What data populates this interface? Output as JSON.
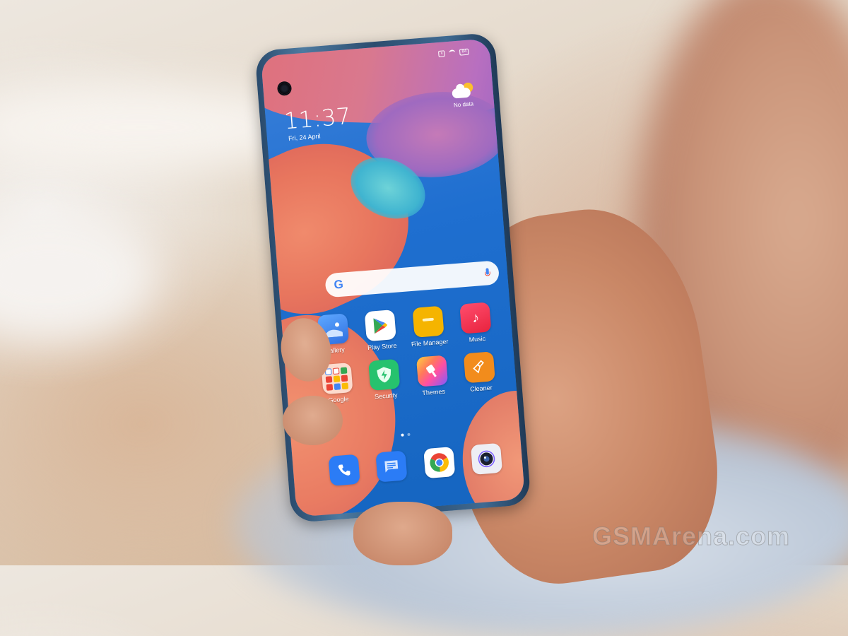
{
  "photo": {
    "description": "Hand holding a smartphone showing its home screen",
    "watermark": "GSMArena.com"
  },
  "phone": {
    "status_bar": {
      "sim_icon": "x",
      "wifi_icon": "wifi",
      "battery_label": "84"
    },
    "clock": {
      "time": "11:37",
      "date": "Fri, 24 April"
    },
    "weather": {
      "icon": "partly-cloudy-icon",
      "label": "No data"
    },
    "search_bar": {
      "logo": "G",
      "mic_icon": "mic-icon"
    },
    "apps": [
      {
        "label": "Gallery",
        "icon": "gallery-icon",
        "color": "#3d8bf2"
      },
      {
        "label": "Play Store",
        "icon": "play-store-icon",
        "color": "#ffffff"
      },
      {
        "label": "File Manager",
        "icon": "folder-icon",
        "color": "#f5b400"
      },
      {
        "label": "Music",
        "icon": "music-note-icon",
        "color": "#f2334a"
      },
      {
        "label": "Google",
        "icon": "google-folder-icon",
        "color": "#f3d7cc"
      },
      {
        "label": "Security",
        "icon": "shield-bolt-icon",
        "color": "#26c26e"
      },
      {
        "label": "Themes",
        "icon": "brush-icon",
        "color": "#f25fa0"
      },
      {
        "label": "Cleaner",
        "icon": "broom-icon",
        "color": "#f28c1c"
      }
    ],
    "page_indicator": {
      "pages": 2,
      "current": 1
    },
    "dock": [
      {
        "name": "Phone",
        "icon": "phone-icon",
        "color": "#2b7cf6"
      },
      {
        "name": "Messages",
        "icon": "message-icon",
        "color": "#2b7cf6"
      },
      {
        "name": "Chrome",
        "icon": "chrome-icon",
        "color": "#ffffff"
      },
      {
        "name": "Camera",
        "icon": "camera-icon",
        "color": "#eeeef4"
      }
    ]
  }
}
